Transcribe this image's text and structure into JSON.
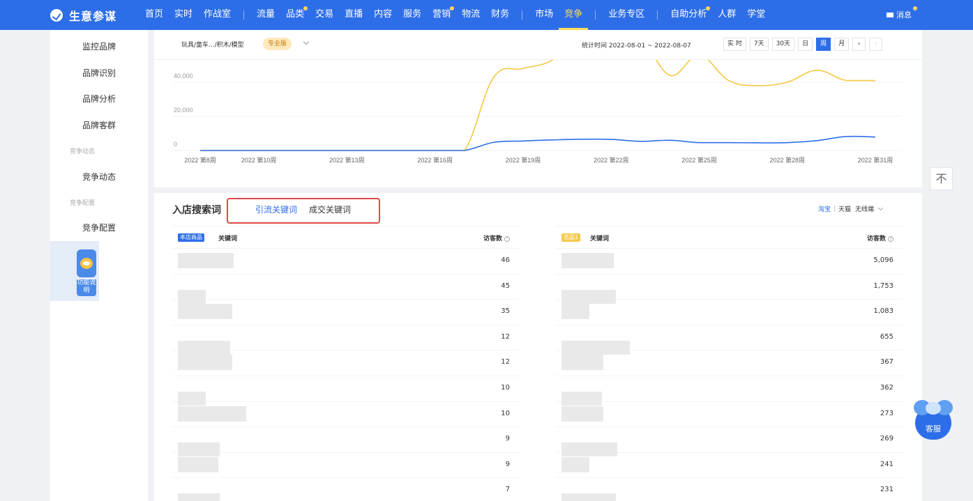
{
  "app": {
    "title": "生意参谋",
    "logo_icon": "compass-logo-icon"
  },
  "topnav": {
    "groups": [
      [
        {
          "label": "首页"
        },
        {
          "label": "实时"
        },
        {
          "label": "作战室"
        }
      ],
      [
        {
          "label": "流量"
        },
        {
          "label": "品类",
          "dot": true
        },
        {
          "label": "交易"
        },
        {
          "label": "直播"
        },
        {
          "label": "内容"
        },
        {
          "label": "服务"
        },
        {
          "label": "营销",
          "dot": true
        },
        {
          "label": "物流"
        },
        {
          "label": "财务"
        }
      ],
      [
        {
          "label": "市场"
        },
        {
          "label": "竞争",
          "active": true
        }
      ],
      [
        {
          "label": "业务专区"
        }
      ],
      [
        {
          "label": "自助分析",
          "dot": true
        },
        {
          "label": "人群"
        },
        {
          "label": "学堂"
        }
      ]
    ],
    "message_label": "消息"
  },
  "sidebar": {
    "items": [
      {
        "label": "监控品牌",
        "type": "item"
      },
      {
        "label": "品牌识别",
        "type": "item"
      },
      {
        "label": "品牌分析",
        "type": "item"
      },
      {
        "label": "品牌客群",
        "type": "item"
      },
      {
        "label": "竞争动态",
        "type": "group"
      },
      {
        "label": "竞争动态",
        "type": "item"
      },
      {
        "label": "竞争配置",
        "type": "group"
      },
      {
        "label": "竞争配置",
        "type": "item"
      }
    ],
    "help_label": "功能说明"
  },
  "filterbar": {
    "category_path": "玩具/童车.../积木/模型",
    "edition_badge": "专业版",
    "stat_time_label": "统计时间 2022-08-01 ~ 2022-08-07",
    "period_buttons": [
      {
        "label": "实 时"
      },
      {
        "label": "7天"
      },
      {
        "label": "30天"
      },
      {
        "label": "日"
      },
      {
        "label": "周",
        "active": true
      },
      {
        "label": "月"
      }
    ],
    "prev_arrow": "‹",
    "next_arrow": "›"
  },
  "chart_data": {
    "type": "line",
    "title": "",
    "xlabel": "",
    "ylabel": "",
    "ylim": [
      0,
      45000
    ],
    "y_ticks": [
      0,
      20000,
      40000
    ],
    "y_tick_labels": [
      "0",
      "20,000",
      "40,000"
    ],
    "x_tick_labels": [
      "2022 第8周",
      "2022 第10周",
      "2022 第13周",
      "2022 第16周",
      "2022 第19周",
      "2022 第22周",
      "2022 第25周",
      "2022 第28周",
      "2022 第31周"
    ],
    "x_tick_weeks": [
      8,
      10,
      13,
      16,
      19,
      22,
      25,
      28,
      31
    ],
    "x_weeks": [
      8,
      9,
      10,
      11,
      12,
      13,
      14,
      15,
      16,
      17,
      18,
      19,
      20,
      21,
      22,
      23,
      24,
      25,
      26,
      27,
      28,
      29,
      30,
      31
    ],
    "series": [
      {
        "color": "#f5c842",
        "values": [
          0,
          0,
          0,
          0,
          0,
          0,
          0,
          0,
          0,
          0,
          43000,
          48000,
          53000,
          68000,
          80000,
          68000,
          44000,
          56000,
          41000,
          38000,
          40000,
          47000,
          41000,
          41000
        ]
      },
      {
        "color": "#2d6ee8",
        "values": [
          0,
          0,
          0,
          0,
          0,
          0,
          0,
          0,
          0,
          0,
          4800,
          5600,
          6200,
          6600,
          6500,
          5400,
          6000,
          4600,
          4600,
          4500,
          4600,
          5800,
          8200,
          7900
        ]
      }
    ],
    "grid": true
  },
  "scroll_top_icon": "不",
  "keywords": {
    "title": "入店搜索词",
    "tabs": [
      {
        "label": "引流关键词",
        "active": true
      },
      {
        "label": "成交关键词"
      }
    ],
    "platform": {
      "options": [
        "淘宝",
        "天猫"
      ],
      "active": "淘宝",
      "device": "无线端"
    },
    "left_table": {
      "badge": "本店商品",
      "col_keyword": "关键词",
      "col_visitors": "访客数",
      "visitors": [
        "46",
        "45",
        "35",
        "12",
        "12",
        "10",
        "10",
        "9",
        "9",
        "7"
      ]
    },
    "right_table": {
      "badge": "竞品1",
      "col_keyword": "关键词",
      "col_visitors": "访客数",
      "visitors": [
        "5,096",
        "1,753",
        "1,083",
        "655",
        "367",
        "362",
        "273",
        "269",
        "241",
        "231"
      ]
    }
  },
  "service_label": "客服"
}
